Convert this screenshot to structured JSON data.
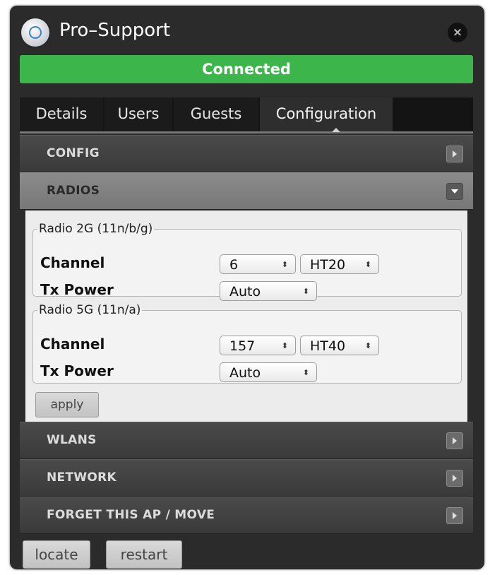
{
  "window": {
    "title": "Pro–Support",
    "app_icon": "access-point-icon",
    "close_icon": "close-icon",
    "close_glyph": "×"
  },
  "status": {
    "text": "Connected",
    "color": "#3cb54a"
  },
  "tabs": [
    {
      "label": "Details"
    },
    {
      "label": "Users"
    },
    {
      "label": "Guests"
    },
    {
      "label": "Configuration",
      "active": true
    }
  ],
  "sections": {
    "config": "CONFIG",
    "radios": "RADIOS",
    "wlans": "WLANS",
    "network": "NETWORK",
    "forget": "FORGET THIS AP / MOVE"
  },
  "radios": {
    "radio_2g": {
      "legend": "Radio 2G (11n/b/g)",
      "channel_label": "Channel",
      "channel": "6",
      "width": "HT20",
      "tx_label": "Tx Power",
      "tx_power": "Auto"
    },
    "radio_5g": {
      "legend": "Radio 5G (11n/a)",
      "channel_label": "Channel",
      "channel": "157",
      "width": "HT40",
      "tx_label": "Tx Power",
      "tx_power": "Auto"
    },
    "apply_label": "apply"
  },
  "footer": {
    "locate_label": "locate",
    "restart_label": "restart"
  },
  "select_glyph": "⬍"
}
